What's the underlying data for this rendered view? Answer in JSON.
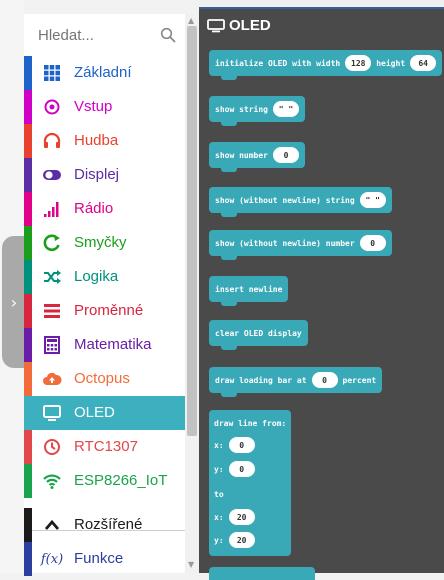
{
  "search": {
    "placeholder": "Hledat..."
  },
  "categories": [
    {
      "label": "Základní",
      "color": "#1e63c9",
      "icon": "grid-icon"
    },
    {
      "label": "Vstup",
      "color": "#d100c6",
      "icon": "target-icon"
    },
    {
      "label": "Hudba",
      "color": "#e8412f",
      "icon": "headphones-icon"
    },
    {
      "label": "Displej",
      "color": "#5b2ea6",
      "icon": "toggle-icon"
    },
    {
      "label": "Rádio",
      "color": "#e0008a",
      "icon": "signal-icon"
    },
    {
      "label": "Smyčky",
      "color": "#1b9e1b",
      "icon": "loop-icon"
    },
    {
      "label": "Logika",
      "color": "#00917c",
      "icon": "shuffle-icon"
    },
    {
      "label": "Proměnné",
      "color": "#d7263d",
      "icon": "lines-icon"
    },
    {
      "label": "Matematika",
      "color": "#6a1ea8",
      "icon": "calculator-icon"
    },
    {
      "label": "Octopus",
      "color": "#f26b3a",
      "icon": "cloud-icon"
    },
    {
      "label": "OLED",
      "color": "#3cb0bf",
      "icon": "monitor-icon",
      "selected": true
    },
    {
      "label": "RTC1307",
      "color": "#e0484a",
      "icon": "clock-icon"
    },
    {
      "label": "ESP8266_IoT",
      "color": "#19a34a",
      "icon": "wifi-icon"
    },
    {
      "label": "Rozšířené",
      "color": "#1b1b1b",
      "icon": "chevron-up-icon"
    },
    {
      "label": "Funkce",
      "color": "#2c3e9e",
      "icon": "function-icon"
    }
  ],
  "flyout": {
    "title": "OLED",
    "blocks": [
      {
        "text": "initialize OLED with width",
        "pill1": "128",
        "text2": "height",
        "pill2": "64"
      },
      {
        "text": "show string",
        "pill1": "\" \""
      },
      {
        "text": "show number",
        "pill1": "0"
      },
      {
        "text": "show (without newline) string",
        "pill1": "\" \""
      },
      {
        "text": "show (without newline) number",
        "pill1": "0"
      },
      {
        "text": "insert newline"
      },
      {
        "text": "clear OLED display"
      },
      {
        "text": "draw loading bar at",
        "pill1": "0",
        "text2": "percent"
      }
    ],
    "draw_line": {
      "title": "draw line from:",
      "x_label": "x:",
      "x1": "0",
      "y_label": "y:",
      "y1": "0",
      "to": "to",
      "x2": "20",
      "y2": "20"
    }
  }
}
